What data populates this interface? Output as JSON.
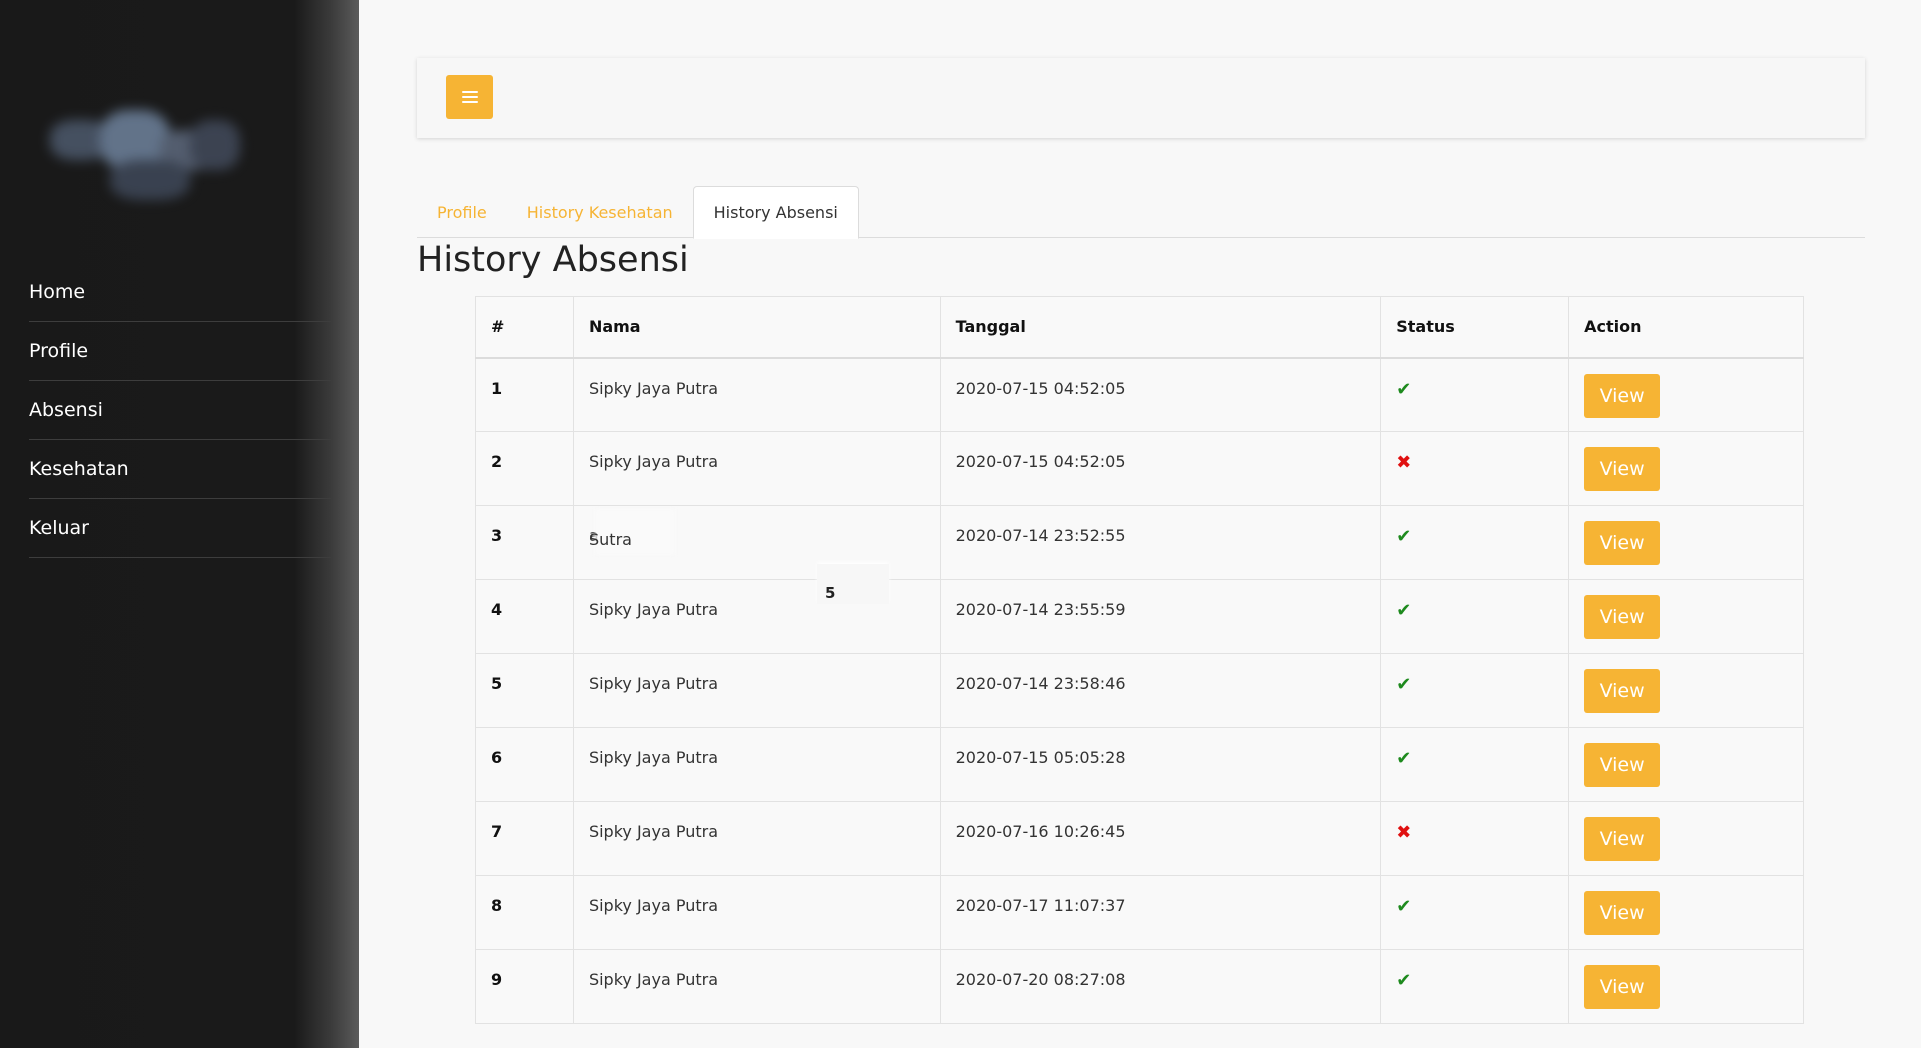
{
  "sidebar": {
    "nav": [
      "Home",
      "Profile",
      "Absensi",
      "Kesehatan",
      "Keluar"
    ]
  },
  "topbar": {
    "menu_icon": "hamburger-icon"
  },
  "tabs": [
    {
      "label": "Profile",
      "active": false
    },
    {
      "label": "History Kesehatan",
      "active": false
    },
    {
      "label": "History Absensi",
      "active": true
    }
  ],
  "page_title": "History Absensi",
  "table": {
    "headers": [
      "#",
      "Nama",
      "Tanggal",
      "Status",
      "Action"
    ],
    "rows": [
      {
        "num": "1",
        "nama": "Sipky Jaya Putra",
        "tanggal": "2020-07-15 04:52:05",
        "status": "ok",
        "action": "View"
      },
      {
        "num": "2",
        "nama": "Sipky Jaya Putra",
        "tanggal": "2020-07-15 04:52:05",
        "status": "bad",
        "action": "View"
      },
      {
        "num": "3",
        "nama": "a Putra",
        "tanggal": "2020-07-14 23:52:55",
        "status": "ok",
        "action": "View"
      },
      {
        "num": "4",
        "nama": "Sipky Jaya Putra",
        "tanggal": "2020-07-14 23:55:59",
        "status": "ok",
        "action": "View"
      },
      {
        "num": "5",
        "nama": "Sipky Jaya Putra",
        "tanggal": "2020-07-14 23:58:46",
        "status": "ok",
        "action": "View"
      },
      {
        "num": "6",
        "nama": "Sipky Jaya Putra",
        "tanggal": "2020-07-15 05:05:28",
        "status": "ok",
        "action": "View"
      },
      {
        "num": "7",
        "nama": "Sipky Jaya Putra",
        "tanggal": "2020-07-16 10:26:45",
        "status": "bad",
        "action": "View"
      },
      {
        "num": "8",
        "nama": "Sipky Jaya Putra",
        "tanggal": "2020-07-17 11:07:37",
        "status": "ok",
        "action": "View"
      },
      {
        "num": "9",
        "nama": "Sipky Jaya Putra",
        "tanggal": "2020-07-20 08:27:08",
        "status": "ok",
        "action": "View"
      }
    ]
  },
  "overlays": {
    "floating_number": "5",
    "floating_text": "Sutra"
  },
  "colors": {
    "accent": "#f6b434",
    "ok": "#1e8a1e",
    "bad": "#e01010",
    "sidebar": "#1a1a1a"
  }
}
